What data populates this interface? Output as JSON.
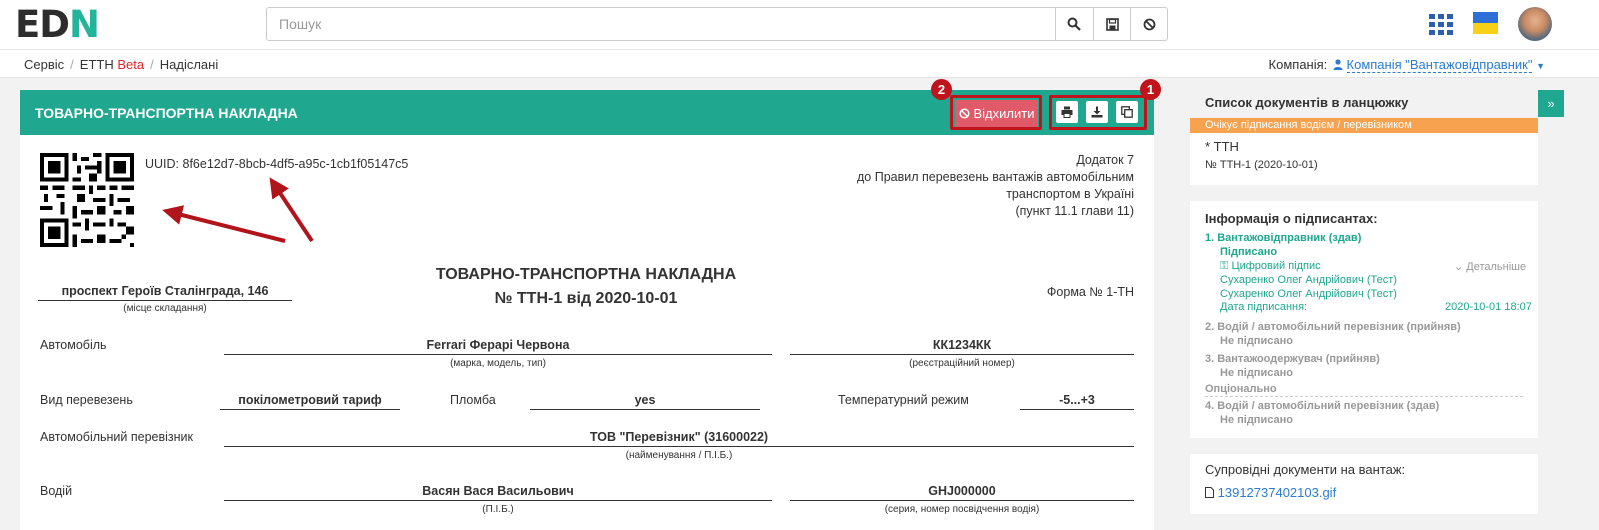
{
  "header": {
    "logo_main": "ED",
    "logo_accent": "N",
    "search_placeholder": "Пошук",
    "icons": [
      "search-icon",
      "save-icon",
      "ban-icon",
      "apps-icon",
      "ukraine-flag-icon",
      "avatar"
    ]
  },
  "breadcrumb": {
    "items": [
      "Сервіс",
      "ЕТТН",
      "Надіслані"
    ],
    "beta": "Beta"
  },
  "company": {
    "label": "Компанія:",
    "value": "Компанія \"Вантажовідправник\""
  },
  "document": {
    "header_title": "ТОВАРНО-ТРАНСПОРТНА НАКЛАДНА",
    "reject_label": "Відхилити",
    "uuid": "UUID: 8f6e12d7-8bcb-4df5-a95c-1cb1f05147c5",
    "addendum": [
      "Додаток 7",
      "до Правил перевезень вантажів автомобільним",
      "транспортом в Україні",
      "(пункт 11.1 глави 11)"
    ],
    "place": "проспект Героїв Сталінграда, 146",
    "place_caption": "(місце складання)",
    "title_line1": "ТОВАРНО-ТРАНСПОРТНА НАКЛАДНА",
    "title_line2": "№ ТТН-1 від 2020-10-01",
    "form_no": "Форма № 1-ТН",
    "car_label": "Автомобіль",
    "car_value": "Ferrari Ферарі Червона",
    "car_caption": "(марка, модель, тип)",
    "reg_value": "КК1234КК",
    "reg_caption": "(реєстраційний номер)",
    "transport_type_label": "Вид перевезень",
    "transport_type_value": "покілометровий тариф",
    "seal_label": "Пломба",
    "seal_value": "yes",
    "temp_label": "Температурний режим",
    "temp_value": "-5...+3",
    "carrier_label": "Автомобільний перевізник",
    "carrier_value": "ТОВ \"Перевізник\" (31600022)",
    "carrier_caption": "(найменування / П.І.Б.)",
    "driver_label": "Водій",
    "driver_value": "Васян Вася Васильович",
    "driver_caption": "(П.І.Б.)",
    "license_value": "GHJ000000",
    "license_caption": "(серия, номер посвідчення водія)"
  },
  "annotations": {
    "badge1": "1",
    "badge2": "2",
    "highlight_color": "#c0131b"
  },
  "chain": {
    "title": "Список документів в ланцюжку",
    "status": "Очікує підписання водієм / перевізником",
    "doc_name": "* ТТН",
    "doc_number": "№ ТТН-1 (2020-10-01)"
  },
  "signers": {
    "title": "Інформація о підписантах:",
    "s1_title": "1.  Вантажовідправник (здав)",
    "s1_status": "Підписано",
    "s1_sig": "Цифровий підпис",
    "s1_details": "Детальніше",
    "s1_name1": "Сухаренко Олег Андрійович (Тест)",
    "s1_name2": "Сухаренко Олег Андрійович (Тест)",
    "s1_date_label": "Дата підписання:",
    "s1_date": "2020-10-01 18:07",
    "s2_title": "2.  Водій / автомобільний перевізник (прийняв)",
    "s2_status": "Не підписано",
    "s3_title": "3.  Вантажоодержувач (прийняв)",
    "s3_status": "Не підписано",
    "optional": "Опціонально",
    "s4_title": "4.  Водій / автомобільний перевізник (здав)",
    "s4_status": "Не підписано"
  },
  "attachments": {
    "title": "Супровідні документи на вантаж:",
    "file": "13912737402103.gif"
  },
  "colors": {
    "accent": "#1fa78f",
    "reject": "#e05a6a",
    "status": "#f6a24e",
    "link": "#2a7bd3"
  }
}
